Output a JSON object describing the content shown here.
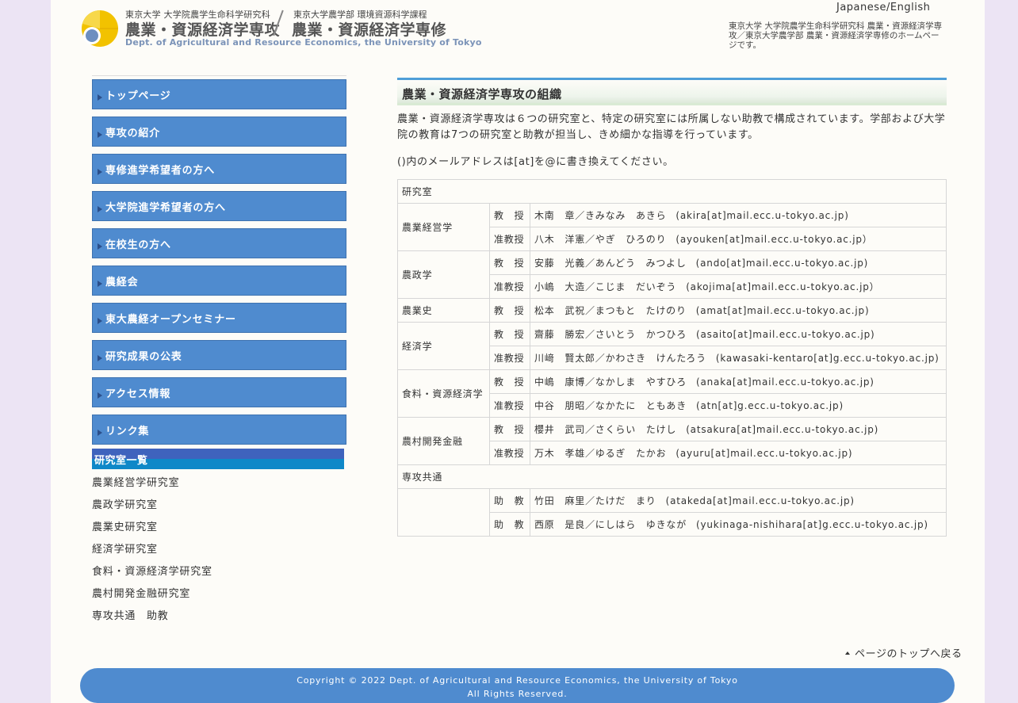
{
  "header": {
    "logo_sub_left": "東京大学 大学院農学生命科学研究科",
    "logo_sub_right": "東京大学農学部 環境資源科学課程",
    "logo_title_left": "農業・資源経済学専攻",
    "logo_title_right": "農業・資源経済学専修",
    "logo_english": "Dept. of Agricultural and Resource Economics, the University of Tokyo",
    "language_link": "Japanese/English",
    "description": "東京大学 大学院農学生命科学研究科 農業・資源経済学専攻／東京大学農学部 農業・資源経済学専修のホームページです。"
  },
  "nav": {
    "items": [
      {
        "label": "トップページ"
      },
      {
        "label": "専攻の紹介"
      },
      {
        "label": "専修進学希望者の方へ"
      },
      {
        "label": "大学院進学希望者の方へ"
      },
      {
        "label": "在校生の方へ"
      },
      {
        "label": "農経会"
      },
      {
        "label": "東大農経オープンセミナー"
      },
      {
        "label": "研究成果の公表"
      },
      {
        "label": "アクセス情報"
      },
      {
        "label": "リンク集"
      }
    ],
    "labs_heading": "研究室一覧",
    "labs": [
      "農業経営学研究室",
      "農政学研究室",
      "農業史研究室",
      "経済学研究室",
      "食料・資源経済学研究室",
      "農村開発金融研究室",
      "専攻共通　助教"
    ]
  },
  "main": {
    "title": "農業・資源経済学専攻の組織",
    "intro": "農業・資源経済学専攻は６つの研究室と、特定の研究室には所属しない助教で構成されています。学部および大学院の教育は7つの研究室と助教が担当し、きめ細かな指導を行っています。",
    "note": "()内のメールアドレスは[at]を@に書き換えてください。",
    "table": {
      "header": "研究室",
      "rows": [
        {
          "lab": "農業経営学",
          "role": "教　授",
          "name": "木南　章／きみなみ　あきら",
          "email": "(akira[at]mail.ecc.u-tokyo.ac.jp)"
        },
        {
          "role": "准教授",
          "name": "八木　洋憲／やぎ　ひろのり",
          "email": "(ayouken[at]mail.ecc.u-tokyo.ac.jp）"
        },
        {
          "lab": "農政学",
          "role": "教　授",
          "name": "安藤　光義／あんどう　みつよし",
          "email": "(ando[at]mail.ecc.u-tokyo.ac.jp)"
        },
        {
          "role": "准教授",
          "name": "小嶋　大造／こじま　だいぞう",
          "email": "(akojima[at]mail.ecc.u-tokyo.ac.jp）"
        },
        {
          "lab": "農業史",
          "role": "教　授",
          "name": "松本　武祝／まつもと　たけのり",
          "email": "(amat[at]mail.ecc.u-tokyo.ac.jp)"
        },
        {
          "lab": "経済学",
          "role": "教　授",
          "name": "齋藤　勝宏／さいとう　かつひろ",
          "email": "(asaito[at]mail.ecc.u-tokyo.ac.jp)"
        },
        {
          "role": "准教授",
          "name": "川﨑　賢太郎／かわさき　けんたろう",
          "email": "(kawasaki-kentaro[at]g.ecc.u-tokyo.ac.jp)"
        },
        {
          "lab": "食料・資源経済学",
          "role": "教　授",
          "name": "中嶋　康博／なかしま　やすひろ",
          "email": "(anaka[at]mail.ecc.u-tokyo.ac.jp)"
        },
        {
          "role": "准教授",
          "name": "中谷　朋昭／なかたに　ともあき",
          "email": "(atn[at]g.ecc.u-tokyo.ac.jp)"
        },
        {
          "lab": "農村開発金融",
          "role": "教　授",
          "name": "櫻井　武司／さくらい　たけし",
          "email": "(atsakura[at]mail.ecc.u-tokyo.ac.jp)"
        },
        {
          "role": "准教授",
          "name": "万木　孝雄／ゆるぎ　たかお",
          "email": "(ayuru[at]mail.ecc.u-tokyo.ac.jp)"
        }
      ],
      "common_header": "専攻共通",
      "common_rows": [
        {
          "role": "助　教",
          "name": "竹田　麻里／たけだ　まり",
          "email": "(atakeda[at]mail.ecc.u-tokyo.ac.jp)"
        },
        {
          "role": "助　教",
          "name": "西原　是良／にしはら　ゆきなが",
          "email": "(yukinaga-nishihara[at]g.ecc.u-tokyo.ac.jp)"
        }
      ]
    }
  },
  "back_to_top": "ページのトップへ戻る",
  "footer": {
    "copyright": "Copyright © 2022 Dept. of Agricultural and Resource Economics, the University of Tokyo",
    "rights": "All Rights Reserved."
  },
  "colors": {
    "nav_blue": "#4f8bcf",
    "title_accent": "#4f9ed8",
    "logo_yellow": "#f2c200"
  }
}
